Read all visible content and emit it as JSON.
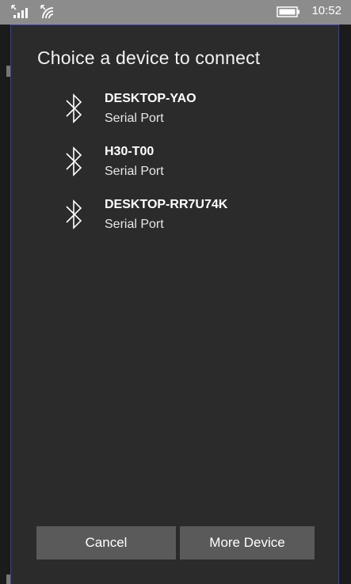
{
  "status_bar": {
    "time": "10:52",
    "icons": [
      "signal-icon",
      "wifi-icon",
      "battery-icon"
    ]
  },
  "dialog": {
    "title": "Choice a device to connect",
    "devices": [
      {
        "name": "DESKTOP-YAO",
        "type": "Serial Port",
        "icon": "bluetooth-icon"
      },
      {
        "name": "H30-T00",
        "type": "Serial Port",
        "icon": "bluetooth-icon"
      },
      {
        "name": "DESKTOP-RR7U74K",
        "type": "Serial Port",
        "icon": "bluetooth-icon"
      }
    ],
    "buttons": {
      "cancel": "Cancel",
      "more": "More Device"
    }
  },
  "colors": {
    "status_bar": "#8c8c8c",
    "dialog_bg": "#2b2b2b",
    "button_bg": "#5a5a5a",
    "border_accent": "#3a3fb0"
  }
}
